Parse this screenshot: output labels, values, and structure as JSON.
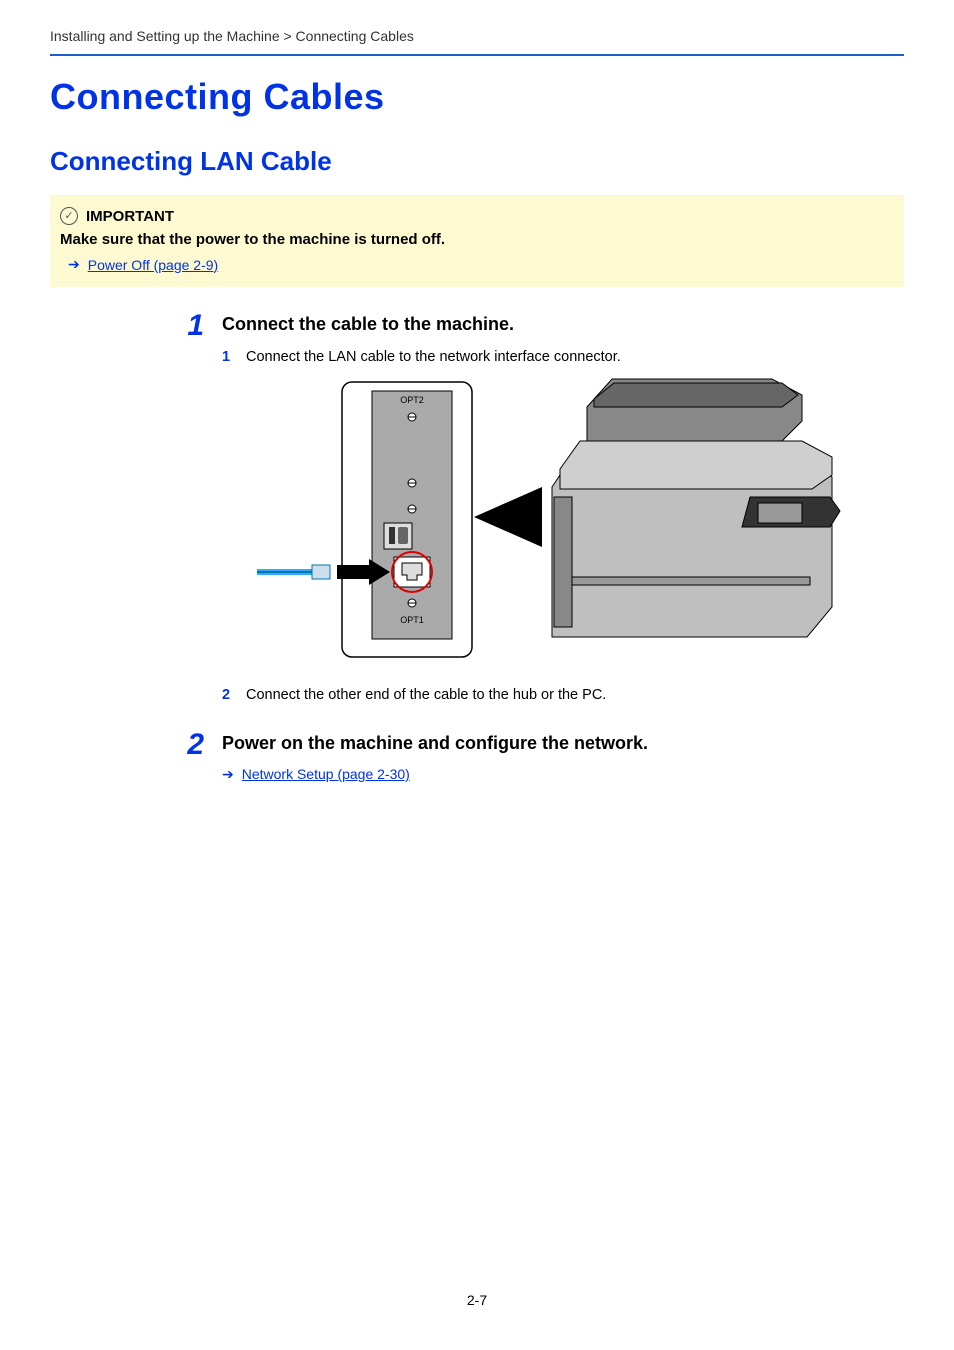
{
  "breadcrumb": "Installing and Setting up the Machine > Connecting Cables",
  "h1": "Connecting Cables",
  "h2": "Connecting LAN Cable",
  "callout": {
    "important_label": "IMPORTANT",
    "text": "Make sure that the power to the machine is turned off.",
    "link": "Power Off (page 2-9)"
  },
  "step1": {
    "num": "1",
    "title": "Connect the cable to the machine.",
    "sub1_num": "1",
    "sub1_text": "Connect the LAN cable to the network interface connector.",
    "fig_opt2": "OPT2",
    "fig_opt1": "OPT1",
    "sub2_num": "2",
    "sub2_text": "Connect the other end of the cable to the hub or the PC."
  },
  "step2": {
    "num": "2",
    "title": "Power on the machine and configure the network.",
    "link": "Network Setup (page 2-30)"
  },
  "page_number": "2-7"
}
